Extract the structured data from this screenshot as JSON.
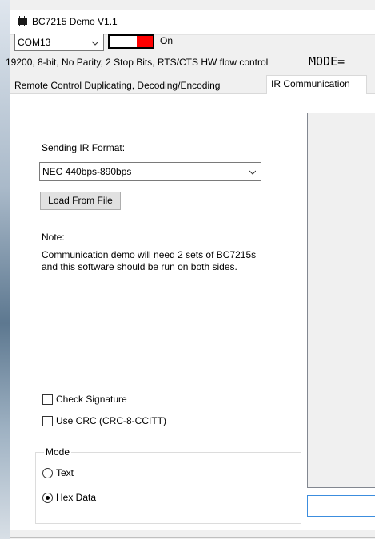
{
  "window": {
    "title": "BC7215 Demo V1.1"
  },
  "connection": {
    "port": "COM13",
    "switch_label": "On",
    "serial_info": "19200, 8-bit, No Parity, 2 Stop Bits, RTS/CTS HW flow control",
    "mode_text": "MODE="
  },
  "tabs": [
    {
      "label": "Remote Control Duplicating, Decoding/Encoding"
    },
    {
      "label": "IR Communication"
    }
  ],
  "ir": {
    "format_label": "Sending IR Format:",
    "format_value": "NEC 440bps-890bps",
    "load_button": "Load From File",
    "note_label": "Note:",
    "note_text": "Communication demo will need 2 sets of BC7215s and this software should be run on both sides.",
    "check_signature": "Check Signature",
    "use_crc": "Use CRC (CRC-8-CCITT)",
    "mode_group": "Mode",
    "mode_text_option": "Text",
    "mode_hex_option": "Hex Data"
  },
  "colors": {
    "switch_on": "#ff0000",
    "input_focus": "#3c8dde"
  },
  "icons": [
    "app-icon",
    "chevron-down-icon"
  ]
}
